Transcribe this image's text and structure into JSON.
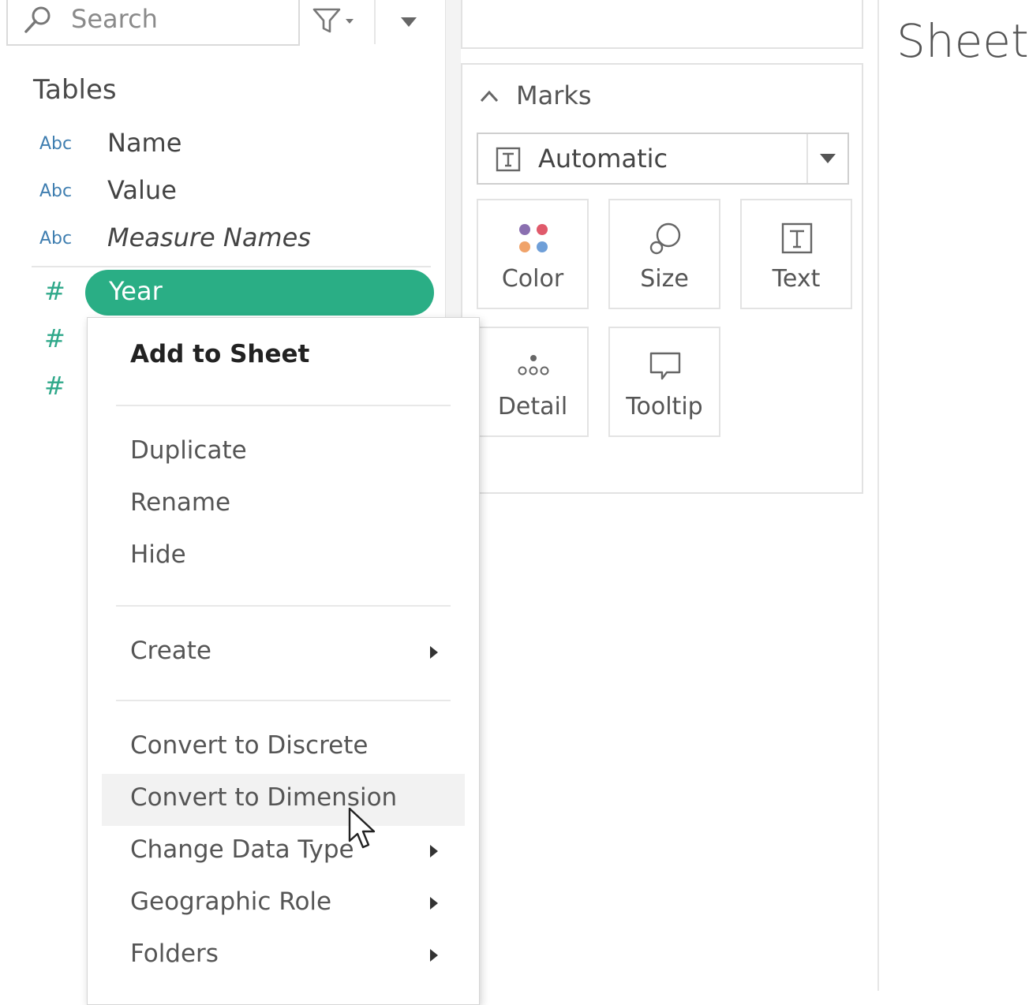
{
  "search": {
    "placeholder": "Search"
  },
  "data_pane": {
    "section_title": "Tables",
    "fields": [
      {
        "type": "Abc",
        "name": "Name"
      },
      {
        "type": "Abc",
        "name": "Value"
      },
      {
        "type": "Abc",
        "name": "Measure Names"
      }
    ],
    "measure_type": "#",
    "selected_field": "Year"
  },
  "marks": {
    "title": "Marks",
    "mark_type": "Automatic",
    "buttons": {
      "color": "Color",
      "size": "Size",
      "text": "Text",
      "detail": "Detail",
      "tooltip": "Tooltip"
    }
  },
  "sheet": {
    "title": "Sheet"
  },
  "context_menu": {
    "items": [
      {
        "label": "Add to Sheet"
      },
      {
        "label": "Duplicate"
      },
      {
        "label": "Rename"
      },
      {
        "label": "Hide"
      },
      {
        "label": "Create"
      },
      {
        "label": "Convert to Discrete"
      },
      {
        "label": "Convert to Dimension"
      },
      {
        "label": "Change Data Type"
      },
      {
        "label": "Geographic Role"
      },
      {
        "label": "Folders"
      }
    ]
  },
  "colors": {
    "accent_green": "#2aae85",
    "type_blue": "#3f7eb0",
    "measure_green": "#2fa88a"
  }
}
